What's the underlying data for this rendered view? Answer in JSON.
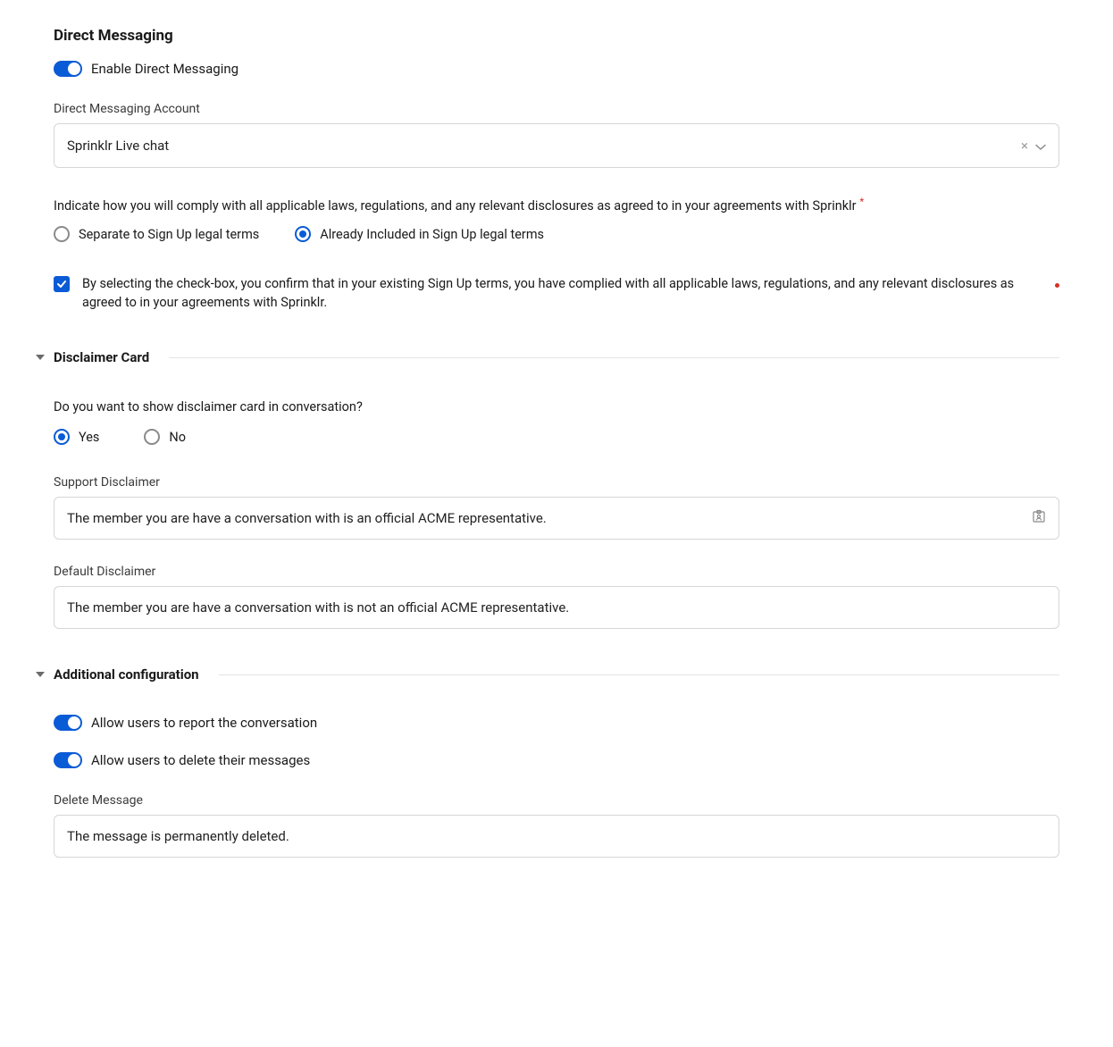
{
  "dm": {
    "title": "Direct Messaging",
    "enable_label": "Enable Direct Messaging",
    "account_label": "Direct Messaging Account",
    "account_value": "Sprinklr Live chat",
    "compliance_text": "Indicate how you will comply with all applicable laws, regulations, and any relevant disclosures as agreed to in your agreements with Sprinklr",
    "radio_separate": "Separate to Sign Up legal terms",
    "radio_included": "Already Included in Sign Up legal terms",
    "radio_selected": "included",
    "confirm_text": "By selecting the check-box, you confirm that in your existing Sign Up terms, you have complied with all applicable laws, regulations, and any relevant disclosures as agreed to in your agreements with Sprinklr."
  },
  "disclaimer": {
    "section_title": "Disclaimer Card",
    "show_question": "Do you want to show disclaimer card in conversation?",
    "yes": "Yes",
    "no": "No",
    "show_selected": "yes",
    "support_label": "Support Disclaimer",
    "support_value": "The member you are have a conversation with is an official ACME representative.",
    "default_label": "Default Disclaimer",
    "default_value": "The member you are have a conversation with is not an official ACME representative."
  },
  "additional": {
    "section_title": "Additional configuration",
    "allow_report": "Allow users to report the conversation",
    "allow_delete": "Allow users to delete their messages",
    "delete_label": "Delete Message",
    "delete_value": "The message is permanently deleted."
  }
}
